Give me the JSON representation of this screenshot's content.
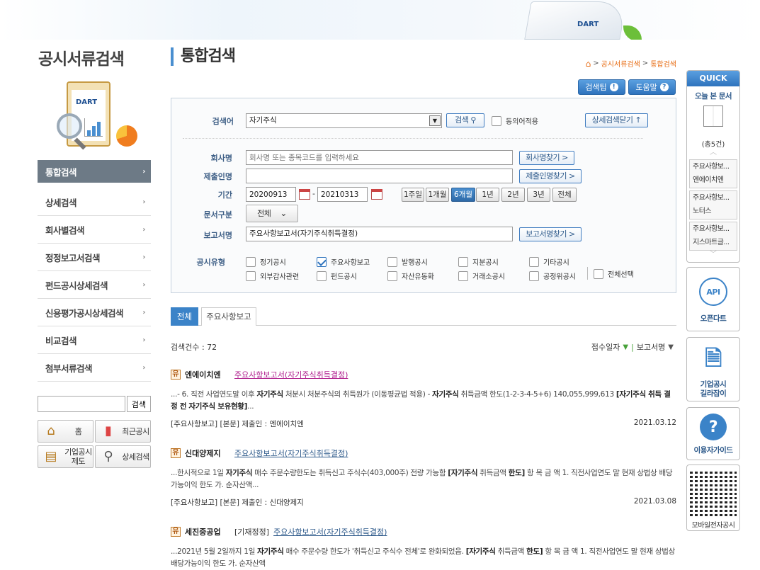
{
  "sidebar": {
    "title": "공시서류검색",
    "menu": [
      {
        "label": "통합검색",
        "active": true
      },
      {
        "label": "상세검색"
      },
      {
        "label": "회사별검색"
      },
      {
        "label": "정정보고서검색"
      },
      {
        "label": "펀드공시상세검색"
      },
      {
        "label": "신용평가공시상세검색"
      },
      {
        "label": "비교검색"
      },
      {
        "label": "첨부서류검색"
      }
    ],
    "search_button": "검색",
    "quick_buttons": [
      {
        "label": "홈",
        "icon": "home-icon"
      },
      {
        "label": "최근공시",
        "icon": "chart-icon"
      },
      {
        "label": "기업공시\n제도",
        "icon": "clipboard-icon"
      },
      {
        "label": "상세검색",
        "icon": "magnifier-icon"
      }
    ]
  },
  "page": {
    "title": "통합검색",
    "breadcrumb": [
      "공시서류검색",
      "통합검색"
    ],
    "tips_button": "검색팁",
    "help_button": "도움말"
  },
  "form": {
    "search_label": "검색어",
    "search_value": "자기주식",
    "search_button": "검색",
    "synonym_label": "동의어적용",
    "detail_button": "상세검색닫기 ↑",
    "company_label": "회사명",
    "company_placeholder": "회사명 또는 종목코드를 입력하세요",
    "company_button": "회사명찾기 >",
    "submitter_label": "제출인명",
    "submitter_value": "",
    "submitter_button": "제출인명찾기 >",
    "period_label": "기간",
    "date_from": "20200913",
    "date_to": "20210313",
    "date_sep": "-",
    "periods": [
      {
        "label": "1주일"
      },
      {
        "label": "1개월"
      },
      {
        "label": "6개월",
        "active": true
      },
      {
        "label": "1년"
      },
      {
        "label": "2년"
      },
      {
        "label": "3년"
      },
      {
        "label": "전체"
      }
    ],
    "doctype_label": "문서구분",
    "doctype_value": "전체",
    "report_label": "보고서명",
    "report_value": "주요사항보고서(자기주식취득결정)",
    "report_button": "보고서명찾기 >",
    "disclosure_label": "공시유형",
    "types_row1": [
      {
        "label": "정기공시",
        "checked": false
      },
      {
        "label": "주요사항보고",
        "checked": true
      },
      {
        "label": "발행공시",
        "checked": false
      },
      {
        "label": "지분공시",
        "checked": false
      },
      {
        "label": "기타공시",
        "checked": false
      }
    ],
    "types_row2": [
      {
        "label": "외부감사관련",
        "checked": false
      },
      {
        "label": "펀드공시",
        "checked": false
      },
      {
        "label": "자산유동화",
        "checked": false
      },
      {
        "label": "거래소공시",
        "checked": false
      },
      {
        "label": "공정위공시",
        "checked": false
      }
    ],
    "select_all": "전체선택"
  },
  "tabs": [
    "전체",
    "주요사항보고"
  ],
  "results": {
    "count_label": "검색건수 : 72",
    "sort_date": "접수일자",
    "sort_name": "보고서명",
    "items": [
      {
        "badge": "유",
        "company": "엔에이치엔",
        "tag": "",
        "report": "주요사항보고서(자기주식취득결정)",
        "snippet_html": "...- 6. 직전 사업연도말 이후 <b>자기주식</b> 처분시 처분주식의 취득원가 (이동평균법 적용) - <b>자기주식</b> 취득금액 한도(1-2-3-4-5+6) 140,055,999,613 <b>[자기주식 취득 결정 전 자기주식 보유현황]</b>...",
        "meta": "[주요사항보고] [본문] 제출인 : 엔에이치엔",
        "date": "2021.03.12"
      },
      {
        "badge": "유",
        "company": "신대양제지",
        "tag": "",
        "report": "주요사항보고서(자기주식취득결정)",
        "snippet_html": "...한시적으로 1일 <b>자기주식</b> 매수 주문수량한도는 취득신고 주식수(403,000주) 전량 가능함 <b>[자기주식</b> 취득금액 <b>한도]</b> 항 목 금 액 1. 직전사업연도 말 현재 상법상 배당가능이익 한도 가. 순자산액...",
        "meta": "[주요사항보고] [본문] 제출인 : 신대양제지",
        "date": "2021.03.08"
      },
      {
        "badge": "유",
        "company": "세진중공업",
        "tag": "[기재정정]",
        "report": "주요사항보고서(자기주식취득결정)",
        "snippet_html": "...2021년 5월 2일까지 1일 <b>자기주식</b> 매수 주문수량 한도가 '취득신고 주식수 전체'로 완화되었음. <b>[자기주식</b> 취득금액 <b>한도]</b> 항 목 금 액 1. 직전사업연도 말 현재 상법상 배당가능이익 한도 가. 순자산액",
        "meta": "",
        "date": ""
      }
    ]
  },
  "quick": {
    "header": "QUICK",
    "title": "오늘 본 문서",
    "count": "(총5건)",
    "items": [
      {
        "line1": "주요사항보...",
        "line2": "엔에이치엔"
      },
      {
        "line1": "주요사항보...",
        "line2": "노터스"
      },
      {
        "line1": "주요사항보...",
        "line2": "지스마트글..."
      }
    ],
    "open_dart": "오픈다트",
    "guide": "기업공시\n길라잡이",
    "user_guide": "이용자가이드",
    "mobile": "모바일전자공시"
  },
  "banner_logo": "DART"
}
